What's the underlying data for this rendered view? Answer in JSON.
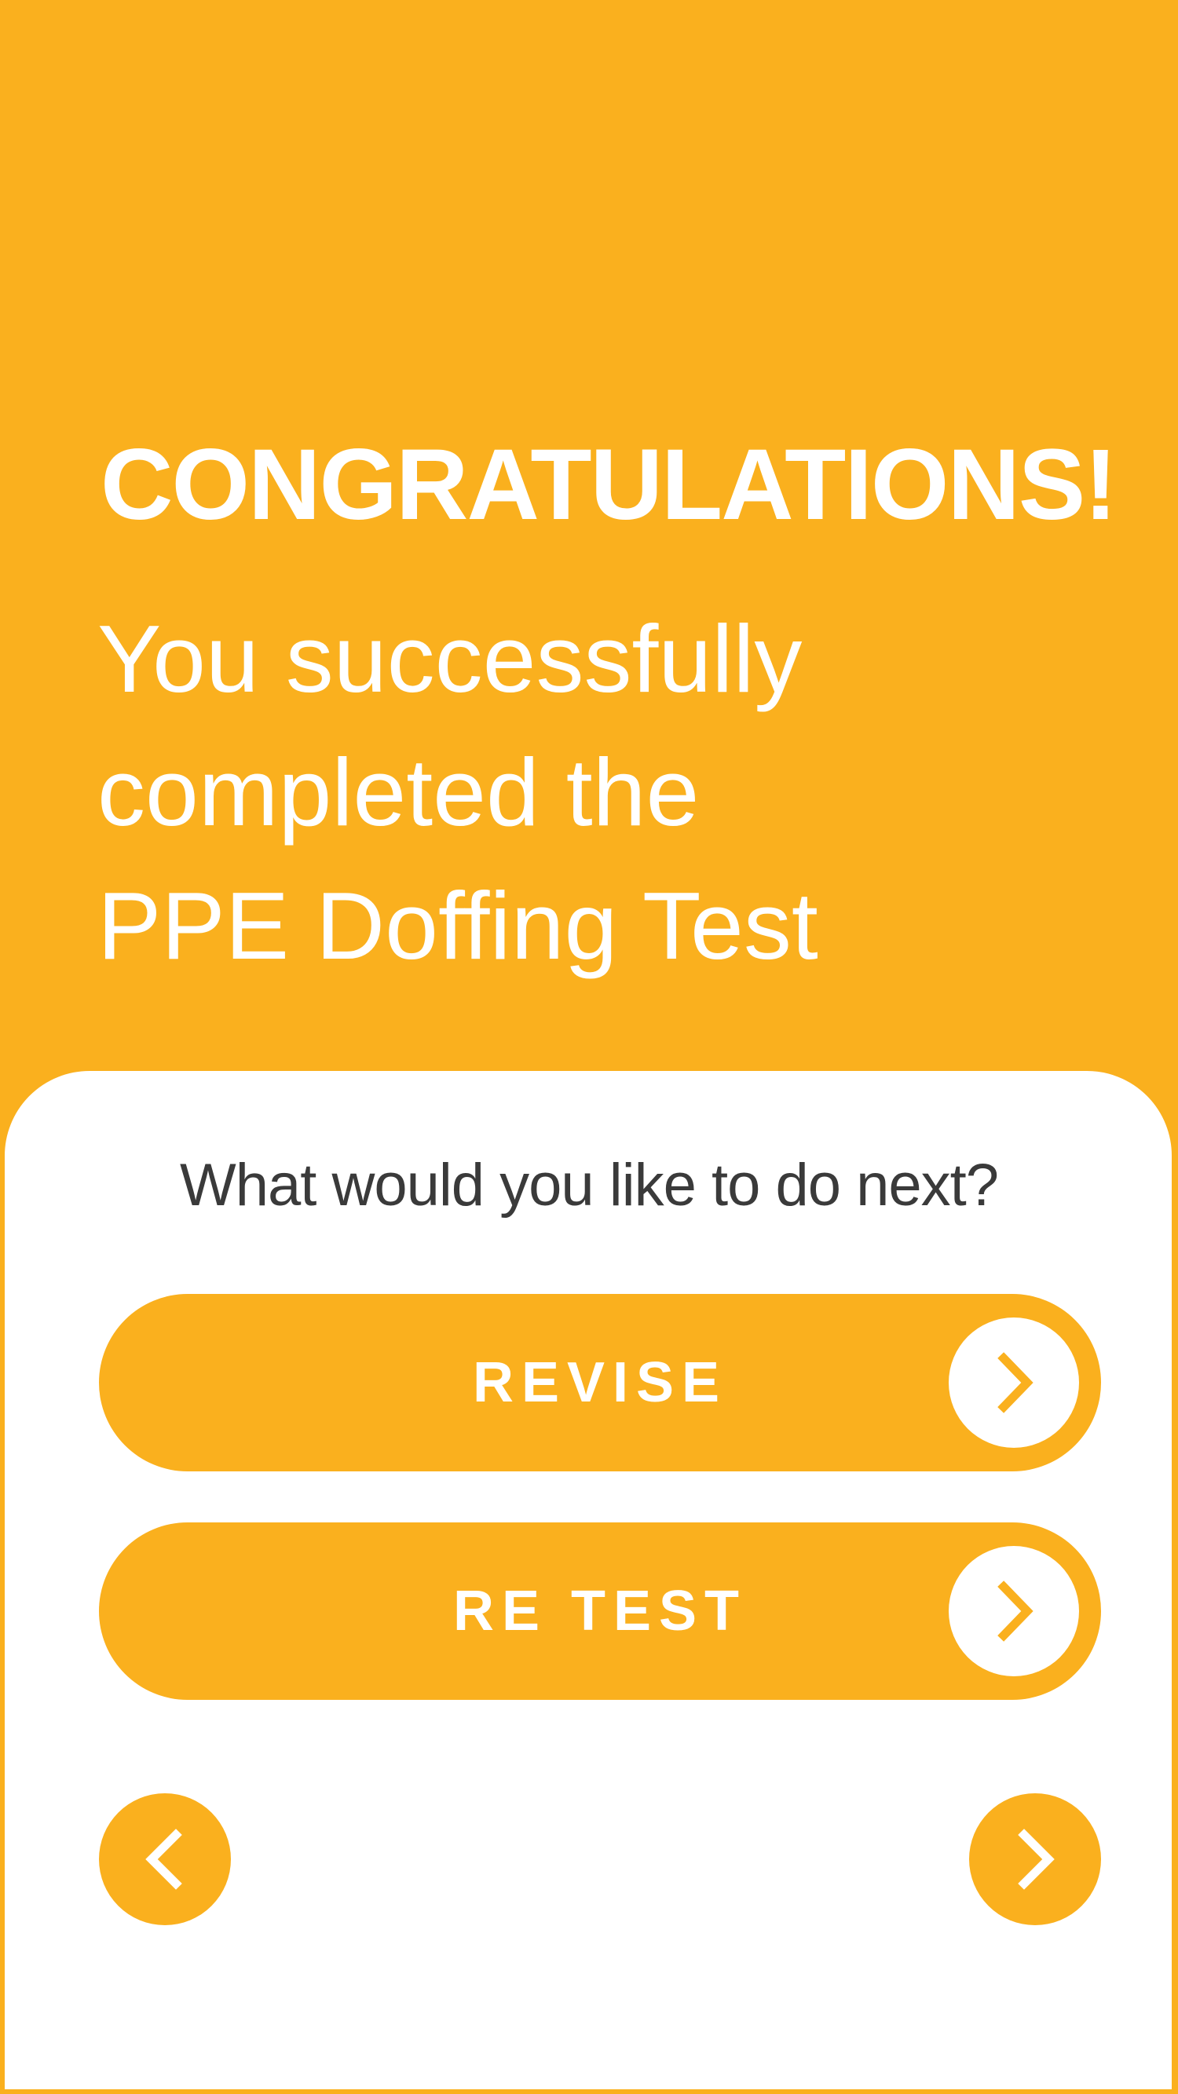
{
  "header": {
    "title": "CONGRATULATIONS!",
    "message_lines": [
      "You successfully",
      "completed the",
      "PPE Doffing Test"
    ]
  },
  "panel": {
    "question": "What would you like to do next?",
    "actions": [
      {
        "label": "REVISE",
        "icon": "chevron-right-icon"
      },
      {
        "label": "RE TEST",
        "icon": "chevron-right-icon"
      }
    ]
  },
  "navigation": {
    "prev_icon": "chevron-left-icon",
    "next_icon": "chevron-right-icon"
  },
  "colors": {
    "brand": "#FAB01E",
    "text_on_brand": "#FFFFFF",
    "panel_background": "#FFFFFF",
    "question_text": "#3A3A3A"
  }
}
